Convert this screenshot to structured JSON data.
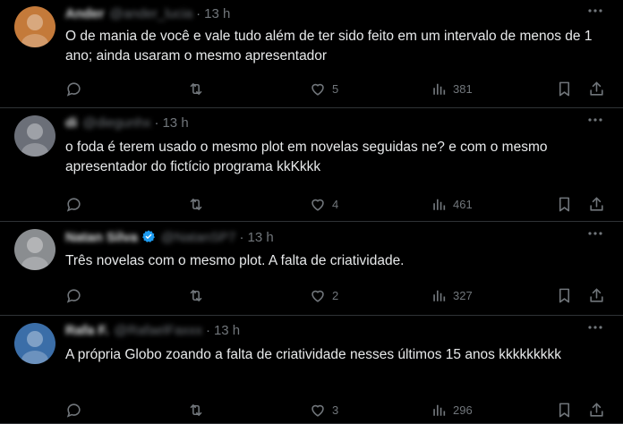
{
  "tweets": [
    {
      "author_name": "Ander",
      "handle": "@ander_lucia",
      "time": "13 h",
      "text": "O de mania de você e vale tudo além de ter sido feito em um intervalo de menos de 1 ano; ainda usaram o mesmo apresentador",
      "replies": "",
      "retweets": "",
      "likes": "5",
      "views": "381",
      "avatar_color": "#c47a3a",
      "verified": false
    },
    {
      "author_name": "di",
      "handle": "@diegunhx",
      "time": "13 h",
      "text": "o foda é terem usado o mesmo plot em novelas seguidas ne? e com o mesmo apresentador do fictício programa kkKkkk",
      "replies": "",
      "retweets": "",
      "likes": "4",
      "views": "461",
      "avatar_color": "#6b6f78",
      "verified": false
    },
    {
      "author_name": "Natan Silva",
      "handle": "@NatanSP7",
      "time": "13 h",
      "text": "Três novelas com o mesmo plot. A falta de criatividade.",
      "replies": "",
      "retweets": "",
      "likes": "2",
      "views": "327",
      "avatar_color": "#8a8d90",
      "verified": true
    },
    {
      "author_name": "Rafa F.",
      "handle": "@RafaelFaxxx",
      "time": "13 h",
      "text": "A própria Globo zoando a falta de criatividade nesses últimos 15 anos kkkkkkkkk",
      "replies": "",
      "retweets": "",
      "likes": "3",
      "views": "296",
      "avatar_color": "#3b6ea8",
      "verified": false
    }
  ],
  "colors": {
    "background": "#000000",
    "text": "#e7e9ea",
    "muted": "#71767b",
    "divider": "#2f3336",
    "verified": "#1d9bf0"
  },
  "icons": [
    "reply-icon",
    "retweet-icon",
    "like-icon",
    "views-icon",
    "bookmark-icon",
    "share-icon",
    "more-icon",
    "verified-badge-icon"
  ]
}
